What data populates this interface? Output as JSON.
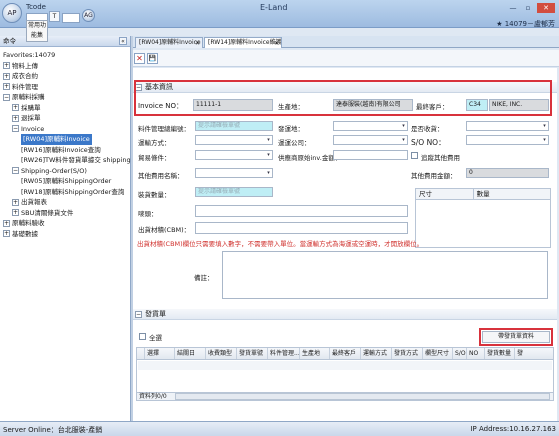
{
  "titlebar": {
    "ap_label": "AP",
    "tcode_label": "Tcode",
    "t_chip": "T",
    "ag_label": "AG",
    "favorites_chip": "常用功能集",
    "app_title": "E-Land",
    "minimize": "—",
    "maximize": "▫",
    "close": "✕",
    "user_info": "★ 14079－盧郁芳"
  },
  "leftpanel": {
    "header": "命令",
    "collapse": "«",
    "items": [
      {
        "label": "Favorites:14079",
        "exp": ""
      },
      {
        "label": "物料上傳",
        "exp": "+"
      },
      {
        "label": "成衣合約",
        "exp": "+"
      },
      {
        "label": "料件管理",
        "exp": "+"
      },
      {
        "label": "原輔料採購",
        "exp": "−"
      },
      {
        "label": "採購單",
        "exp": "+"
      },
      {
        "label": "退採單",
        "exp": "+"
      },
      {
        "label": "Invoice",
        "exp": "−"
      },
      {
        "label": "[RW04]原輔料Invoice",
        "exp": ""
      },
      {
        "label": "[RW16]原輔料Invoice查詢",
        "exp": ""
      },
      {
        "label": "[RW26]TW料件發貨單據交 shipping",
        "exp": ""
      },
      {
        "label": "Shipping-Order(S/O)",
        "exp": "−"
      },
      {
        "label": "[RW05]原輔料ShippingOrder",
        "exp": ""
      },
      {
        "label": "[RW18]原輔料ShippingOrder查詢",
        "exp": ""
      },
      {
        "label": "出貨報表",
        "exp": "+"
      },
      {
        "label": "SBU清關條貨文件",
        "exp": "+"
      },
      {
        "label": "原輔料驗收",
        "exp": "+"
      },
      {
        "label": "基礎數據",
        "exp": "+"
      }
    ]
  },
  "tabs": [
    {
      "label": "[RW04]原輔料Invoice",
      "close": "✕"
    },
    {
      "label": "[RW14]原輔料Invoice維護",
      "close": "✕"
    }
  ],
  "toolbar": {
    "close_glyph": "✕",
    "save_glyph": "💾"
  },
  "basic": {
    "header": "基本資訊",
    "invoice_no_label": "Invoice NO：",
    "invoice_no": "11111-1",
    "origin_label": "生產地：",
    "origin": "達泰服裝(越南)有限公司",
    "customer_label": "最終客戶：",
    "customer_code": "C34",
    "customer_name": "NIKE, INC.",
    "mgmt_label": "料件管理總編號：",
    "mgmt_placeholder": "提示請確檢單號",
    "dest_label": "發運地：",
    "partial_label": "是否收貨：",
    "ship_mode_label": "運輸方式：",
    "ship_co_label": "運運公司：",
    "so_label": "S/O NO：",
    "trade_label": "貿易條件：",
    "ref_inv_label": "供應商原始inv.金額：",
    "other_fee_check": "追蹤其他費用",
    "other_fee_name_label": "其他費用名稱：",
    "other_fee_amt_label": "其他費用金額：",
    "other_fee_amt": "0",
    "loading_label": "裝貨數量：",
    "loading_placeholder": "提示請確檢單號",
    "size_col": "尺寸",
    "qty_col": "數量",
    "marks_label": "嘜頭：",
    "volume_label": "出貨材積(CBM)：",
    "notice": "出貨材積(CBM)欄位只需要填入數字，不需要帶入單位。當運輸方式為海運或空運時，才開放欄位。",
    "remarks_label": "備註："
  },
  "shipment": {
    "header": "發貨單",
    "select_all": "全選",
    "load_button": "帶發貨單資料",
    "columns": [
      "選擇",
      "結關日",
      "收費類型",
      "發貨單號",
      "料件管理...",
      "生產地",
      "最終客戶",
      "運輸方式",
      "發貨方式",
      "欄型尺寸",
      "S/O",
      "NO",
      "發貨數量",
      "發"
    ],
    "footer": "資料列0/0"
  },
  "status": {
    "server": "Server Online：台北服裝-產銷",
    "ip": "IP Address:10.16.27.163"
  }
}
